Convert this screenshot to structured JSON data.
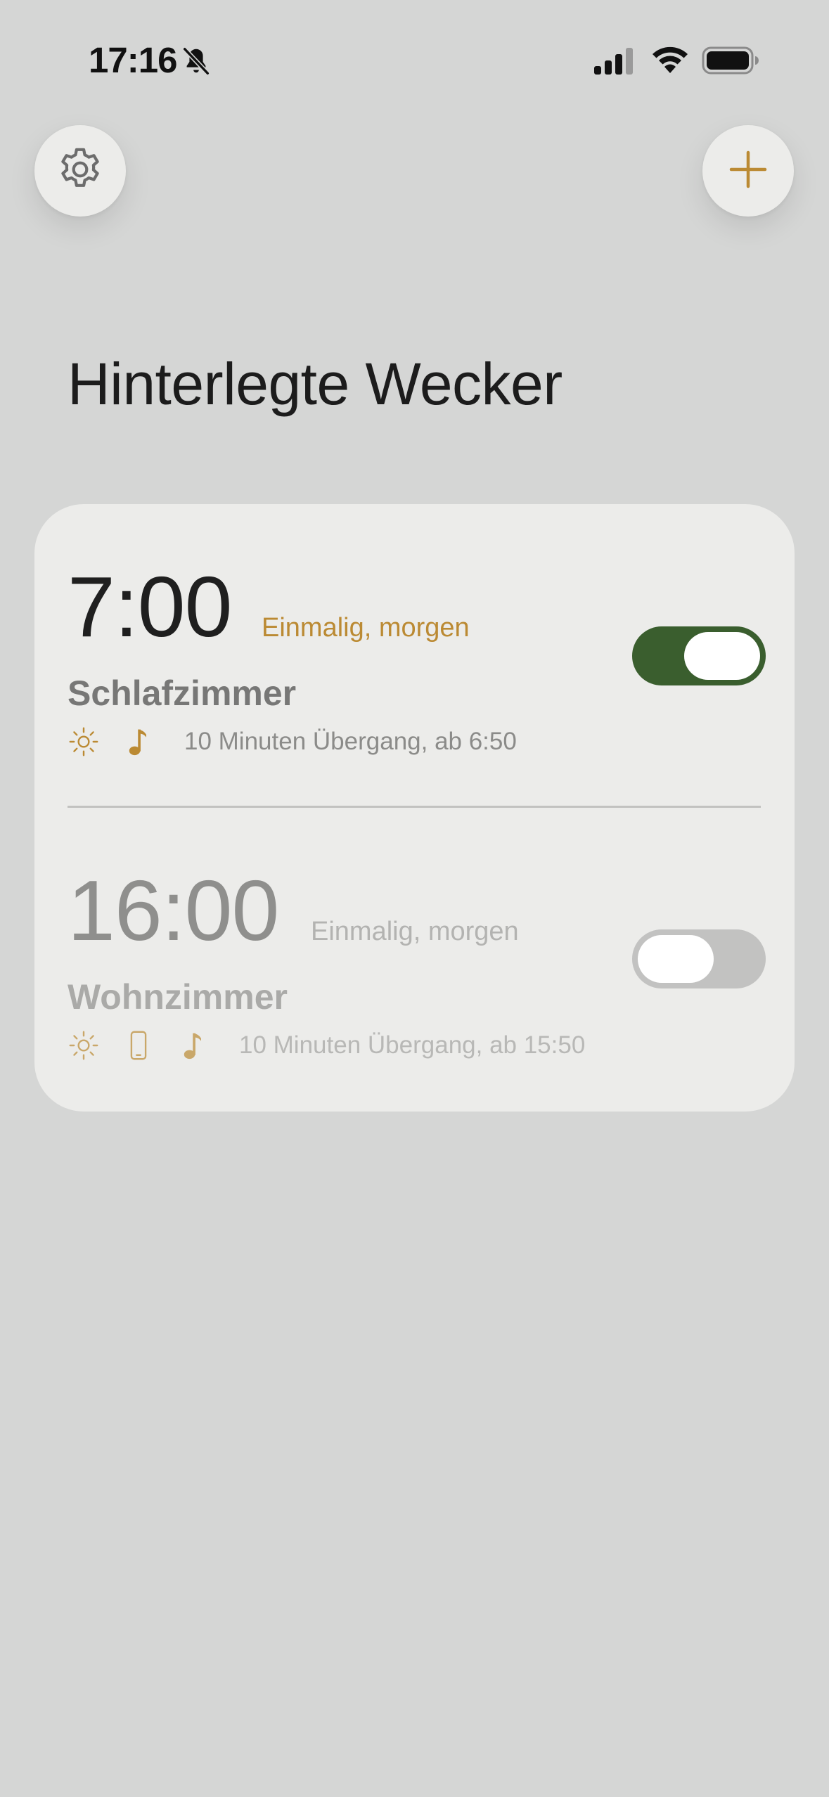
{
  "status_bar": {
    "time": "17:16",
    "icons": [
      "bell-slash-icon",
      "cellular-signal-icon",
      "wifi-icon",
      "battery-icon"
    ]
  },
  "header": {
    "settings_icon": "gear-icon",
    "add_icon": "plus-icon"
  },
  "page": {
    "title": "Hinterlegte Wecker"
  },
  "colors": {
    "background": "#d5d6d5",
    "card": "#ececea",
    "accent": "#bb8a33",
    "toggle_on": "#3a5e2e",
    "toggle_off": "#c2c2c1"
  },
  "alarms": [
    {
      "time": "7:00",
      "repeat": "Einmalig, morgen",
      "room": "Schlafzimmer",
      "icons": [
        "sun-icon",
        "music-note-icon"
      ],
      "transition": "10 Minuten Übergang, ab 6:50",
      "enabled": true
    },
    {
      "time": "16:00",
      "repeat": "Einmalig, morgen",
      "room": "Wohnzimmer",
      "icons": [
        "sun-icon",
        "phone-icon",
        "music-note-icon"
      ],
      "transition": "10 Minuten Übergang, ab 15:50",
      "enabled": false
    }
  ]
}
